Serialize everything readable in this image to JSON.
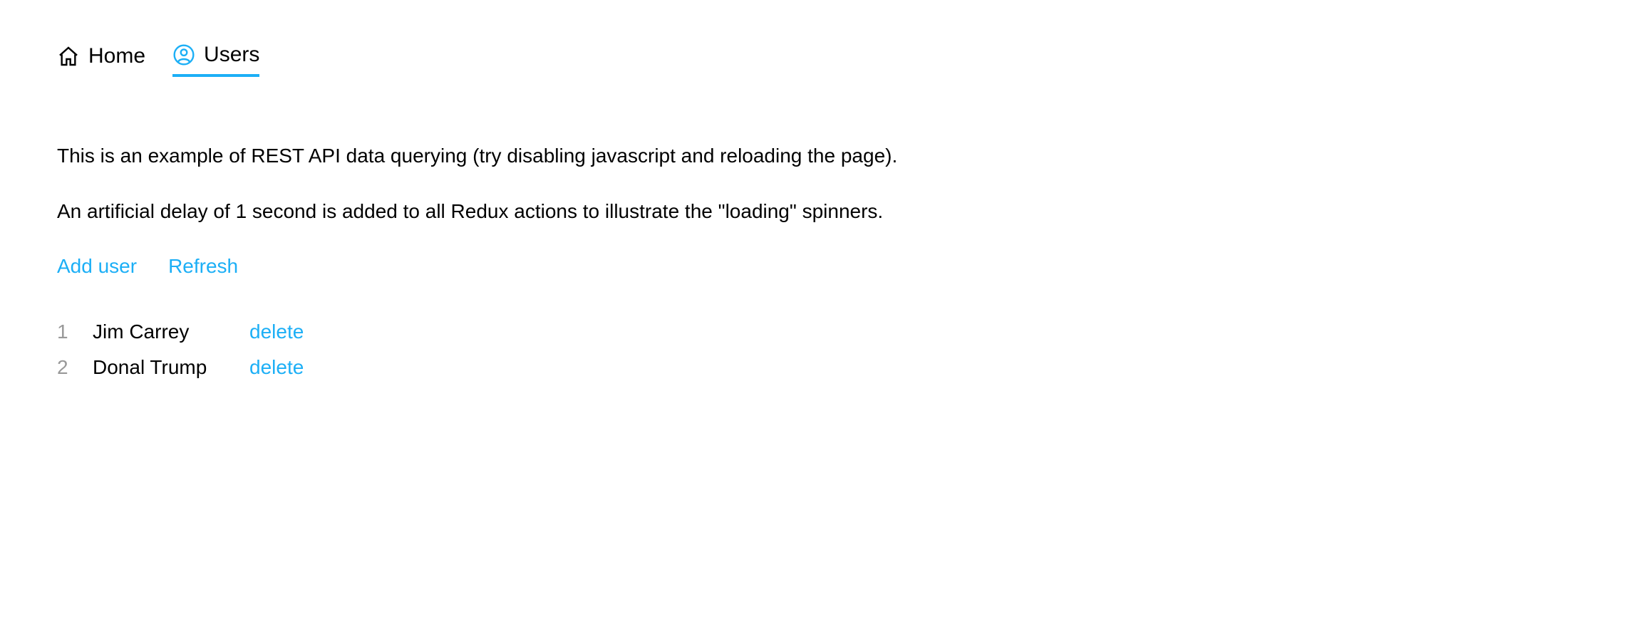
{
  "nav": {
    "home": {
      "label": "Home"
    },
    "users": {
      "label": "Users"
    }
  },
  "description": {
    "line1": "This is an example of REST API data querying (try disabling javascript and reloading the page).",
    "line2": "An artificial delay of 1 second is added to all Redux actions to illustrate the \"loading\" spinners."
  },
  "actions": {
    "add_user": "Add user",
    "refresh": "Refresh"
  },
  "users": [
    {
      "id": "1",
      "name": "Jim Carrey",
      "delete_label": "delete"
    },
    {
      "id": "2",
      "name": "Donal Trump",
      "delete_label": "delete"
    }
  ]
}
